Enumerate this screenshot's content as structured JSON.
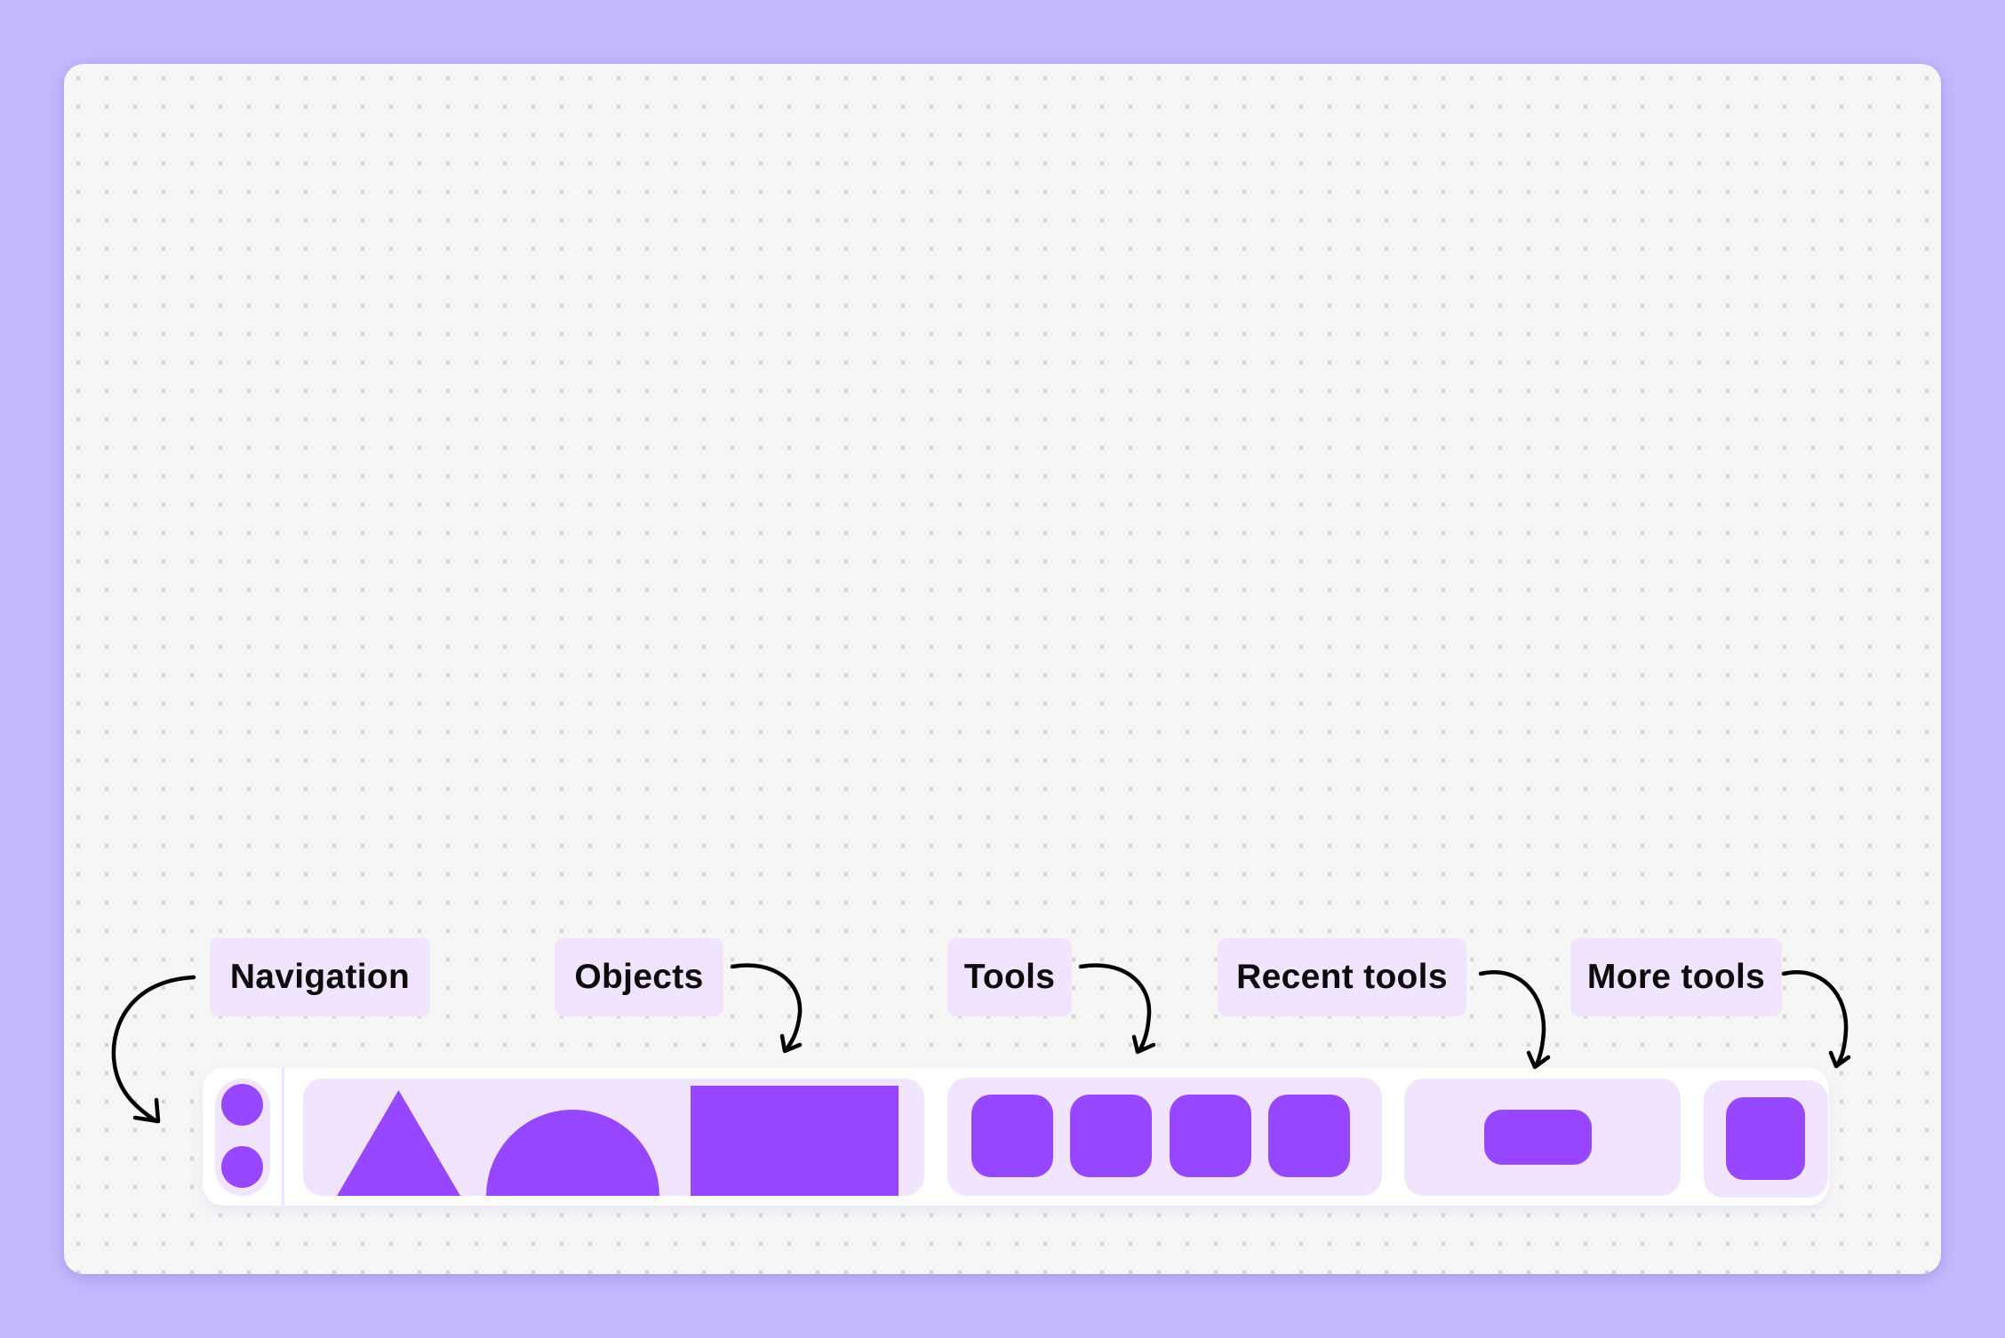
{
  "labels": {
    "navigation": "Navigation",
    "objects": "Objects",
    "tools": "Tools",
    "recent_tools": "Recent tools",
    "more_tools": "More tools"
  },
  "toolbar": {
    "navigation_items": [
      "nav-circle",
      "nav-circle"
    ],
    "objects": [
      "triangle",
      "semicircle",
      "rectangle"
    ],
    "tools_count": 4,
    "recent_tools_count": 1,
    "more_tools_count": 1
  },
  "colors": {
    "background": "#c5b9fe",
    "canvas": "#f6f6f6",
    "panel": "#f1e4fe",
    "primary": "#9747ff",
    "text": "#0c0c0c"
  }
}
